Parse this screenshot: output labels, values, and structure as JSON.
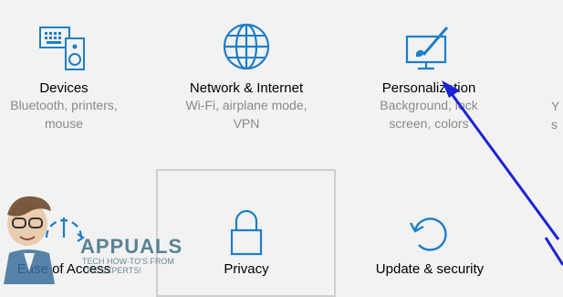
{
  "tiles": {
    "devices": {
      "title": "Devices",
      "desc": [
        "Bluetooth, printers,",
        "mouse"
      ]
    },
    "network": {
      "title": "Network & Internet",
      "desc": [
        "Wi-Fi, airplane mode,",
        "VPN"
      ]
    },
    "personalization": {
      "title": "Personalization",
      "desc": [
        "Background, lock",
        "screen, colors"
      ]
    },
    "partial_right": {
      "desc": [
        "Y",
        "s"
      ]
    },
    "ease": {
      "title": "Ease of Access"
    },
    "privacy": {
      "title": "Privacy"
    },
    "update": {
      "title": "Update & security"
    }
  },
  "watermark": {
    "brand": "APPUALS",
    "sub": [
      "TECH HOW-TO'S FROM",
      "THE EXPERTS!"
    ]
  },
  "colors": {
    "accent": "#1e7ec8",
    "arrow": "#1c22d6"
  }
}
